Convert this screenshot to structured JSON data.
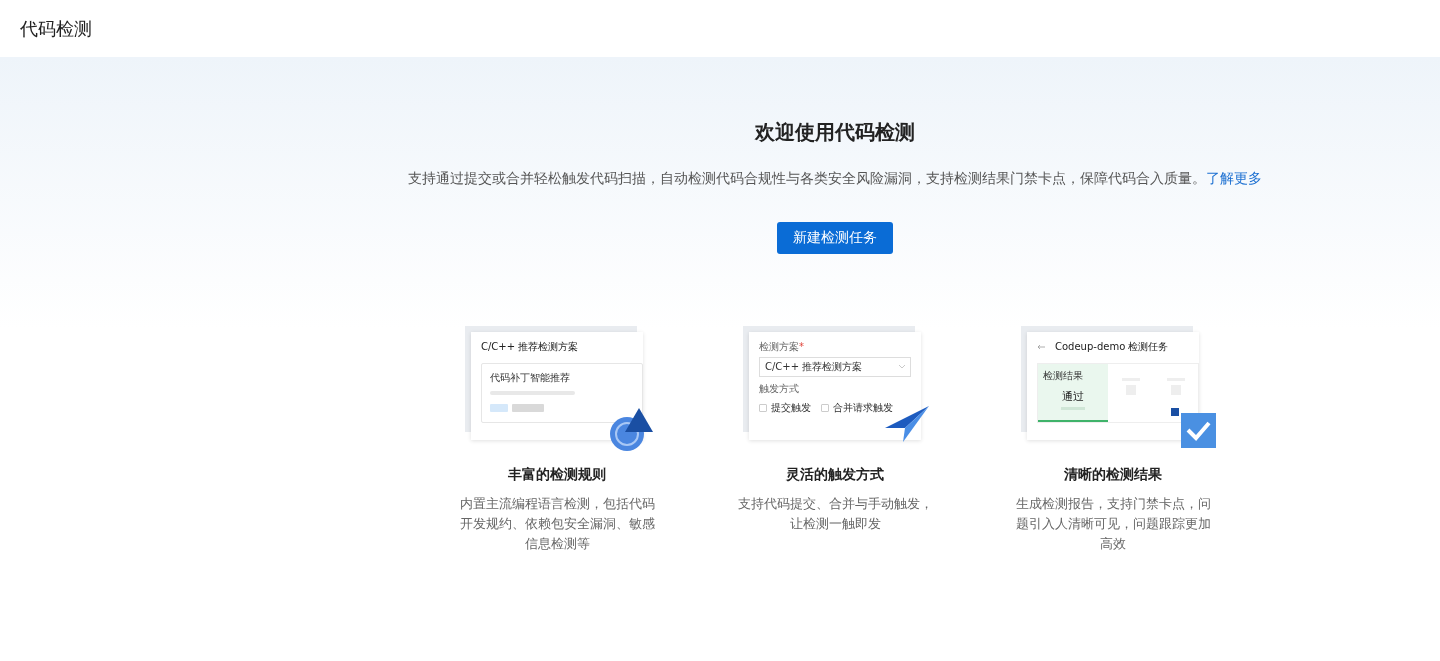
{
  "header": {
    "title": "代码检测"
  },
  "welcome": {
    "title": "欢迎使用代码检测",
    "description": "支持通过提交或合并轻松触发代码扫描，自动检测代码合规性与各类安全风险漏洞，支持检测结果门禁卡点，保障代码合入质量。",
    "link": "了解更多",
    "button": "新建检测任务"
  },
  "features": [
    {
      "kind": "rules",
      "title": "丰富的检测规则",
      "description": "内置主流编程语言检测，包括代码开发规约、依赖包安全漏洞、敏感信息检测等",
      "mock": {
        "heading": "C/C++ 推荐检测方案",
        "item": "代码补丁智能推荐"
      }
    },
    {
      "kind": "trigger",
      "title": "灵活的触发方式",
      "description": "支持代码提交、合并与手动触发，让检测一触即发",
      "mock": {
        "label": "检测方案",
        "required": "*",
        "select": "C/C++ 推荐检测方案",
        "trigger_label": "触发方式",
        "options": [
          {
            "label": "提交触发",
            "checked": false
          },
          {
            "label": "合并请求触发",
            "checked": false
          }
        ]
      }
    },
    {
      "kind": "result",
      "title": "清晰的检测结果",
      "description": "生成检测报告，支持门禁卡点，问题引入人清晰可见，问题跟踪更加高效",
      "mock": {
        "heading": "Codeup-demo 检测任务",
        "result_label": "检测结果",
        "result": "通过"
      }
    }
  ]
}
